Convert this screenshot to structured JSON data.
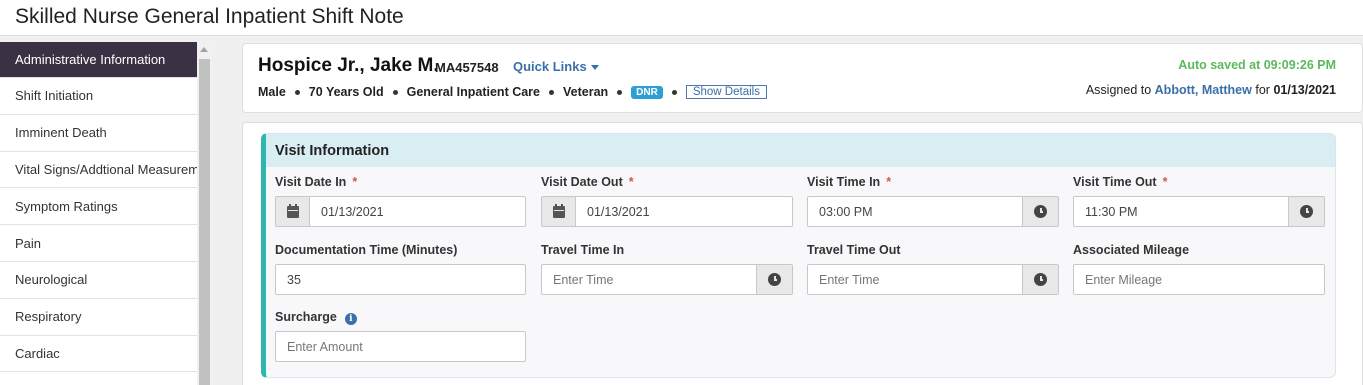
{
  "page_title": "Skilled Nurse General Inpatient Shift Note",
  "sidebar": {
    "items": [
      {
        "label": "Administrative Information",
        "active": true
      },
      {
        "label": "Shift Initiation"
      },
      {
        "label": "Imminent Death"
      },
      {
        "label": "Vital Signs/Addtional Measurements"
      },
      {
        "label": "Symptom Ratings"
      },
      {
        "label": "Pain"
      },
      {
        "label": "Neurological"
      },
      {
        "label": "Respiratory"
      },
      {
        "label": "Cardiac"
      }
    ]
  },
  "patient": {
    "name": "Hospice Jr., Jake M.",
    "mrn": "MA457548",
    "quick_links": "Quick Links",
    "sex": "Male",
    "age": "70 Years Old",
    "care_type": "General Inpatient Care",
    "status": "Veteran",
    "badge": "DNR",
    "show_details": "Show Details",
    "auto_saved": "Auto saved at 09:09:26 PM",
    "assigned_prefix": "Assigned to",
    "assigned_to": "Abbott, Matthew",
    "assigned_for": "for",
    "assigned_date": "01/13/2021"
  },
  "visit": {
    "section_title": "Visit Information",
    "required_mark": "*",
    "visit_date_in": {
      "label": "Visit Date In",
      "value": "01/13/2021"
    },
    "visit_date_out": {
      "label": "Visit Date Out",
      "value": "01/13/2021"
    },
    "visit_time_in": {
      "label": "Visit Time In",
      "value": "03:00 PM"
    },
    "visit_time_out": {
      "label": "Visit Time Out",
      "value": "11:30 PM"
    },
    "documentation_time": {
      "label": "Documentation Time (Minutes)",
      "value": "35"
    },
    "travel_time_in": {
      "label": "Travel Time In",
      "placeholder": "Enter Time"
    },
    "travel_time_out": {
      "label": "Travel Time Out",
      "placeholder": "Enter Time"
    },
    "associated_mileage": {
      "label": "Associated Mileage",
      "placeholder": "Enter Mileage"
    },
    "surcharge": {
      "label": "Surcharge",
      "placeholder": "Enter Amount",
      "info_glyph": "i"
    }
  },
  "colors": {
    "sidebar_active": "#3b3144",
    "link": "#3a6fa8",
    "autosave": "#5cb85c",
    "section_accent": "#2fb6b0",
    "required": "#d9534f",
    "badge": "#2e9fd4"
  },
  "icons": [
    "calendar-icon",
    "clock-icon",
    "info-icon",
    "chevron-down-icon",
    "scroll-up-arrow-icon"
  ]
}
